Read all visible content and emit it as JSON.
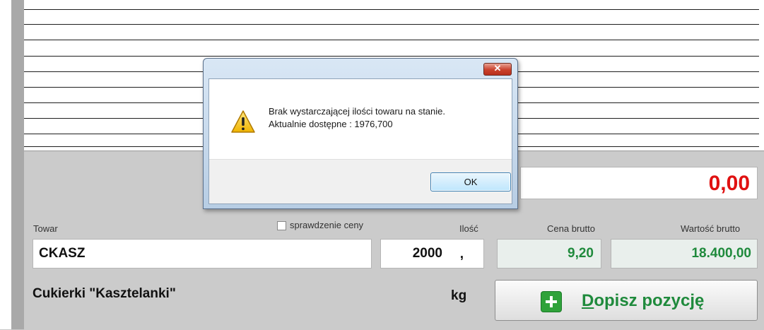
{
  "dialog": {
    "message_line1": "Brak wystarczającej ilości towaru na stanie.",
    "message_line2": "Aktualnie dostępne : 1976,700",
    "ok_label": "OK",
    "close_label": "✕",
    "icon": "warning-icon"
  },
  "summary": {
    "total": "0,00"
  },
  "form": {
    "towar_label": "Towar",
    "price_check_label": "sprawdzenie ceny",
    "ilosc_label": "Ilość",
    "cena_label": "Cena brutto",
    "wartosc_label": "Wartość brutto",
    "towar_value": "CKASZ",
    "ilosc_value": "2000",
    "ilosc_decimal_sep": ",",
    "cena_value": "9,20",
    "wartosc_value": "18.400,00",
    "product_name": "Cukierki \"Kasztelanki\"",
    "unit": "kg",
    "add_button_first_letter": "D",
    "add_button_rest": "opisz pozycję"
  },
  "colors": {
    "total_red": "#e01111",
    "value_green": "#1f8a3c"
  }
}
